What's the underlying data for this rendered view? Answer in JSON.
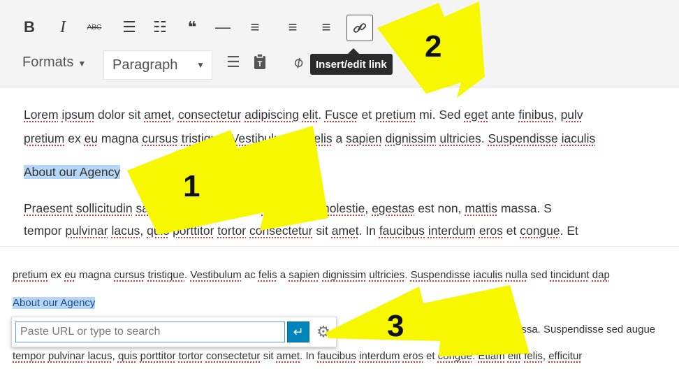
{
  "toolbar": {
    "row1": [
      {
        "name": "bold-button",
        "glyph": "B"
      },
      {
        "name": "italic-button",
        "glyph": "I"
      },
      {
        "name": "strikethrough-button",
        "glyph": "ABC"
      },
      {
        "name": "bulleted-list-button",
        "glyph": "☰"
      },
      {
        "name": "numbered-list-button",
        "glyph": "☷"
      },
      {
        "name": "blockquote-button",
        "glyph": "❝"
      },
      {
        "name": "horizontal-line-button",
        "glyph": "—"
      },
      {
        "name": "align-left-button",
        "glyph": "≡"
      },
      {
        "name": "align-center-button",
        "glyph": "≡"
      },
      {
        "name": "align-right-button",
        "glyph": "≡"
      },
      {
        "name": "insert-link-button",
        "glyph": "🔗"
      }
    ],
    "formats_label": "Formats",
    "paragraph_value": "Paragraph",
    "tooltip": "Insert/edit link"
  },
  "editor": {
    "line1": "Lorem ipsum dolor sit amet, consectetur adipiscing elit. Fusce et pretium mi. Sed eget ante finibus, pulv",
    "line2": "pretium ex eu magna cursus tristique. Vestibulum ac felis a sapien dignissim ultricies. Suspendisse iaculis",
    "heading_selected": "About our Agency",
    "line3": "Praesent sollicitudin sapien c sit amet eros molestie, egestas est non, mattis massa.",
    "line4": "tempor pulvinar lacus, quis porttitor tortor consectetur sit amet. In faucibus interdum eros et congue. Et"
  },
  "bottom": {
    "line1": "pretium ex eu magna cursus tristique. Vestibulum ac felis a sapien dignissim ultricies. Suspendisse iaculis nulla sed tincidunt dap",
    "heading": "About our Agency",
    "line_right": "assa. Suspendisse sed augue",
    "line_bottom": "tempor pulvinar lacus, quis porttitor tortor consectetur sit amet. In faucibus interdum eros et congue. Etiam elit felis, efficitur",
    "url_placeholder": "Paste URL or type to search",
    "apply_icon": "↵",
    "settings_icon": "⚙"
  },
  "annotations": {
    "step1": "1",
    "step2": "2",
    "step3": "3",
    "arrow_color": "#f7f700"
  }
}
